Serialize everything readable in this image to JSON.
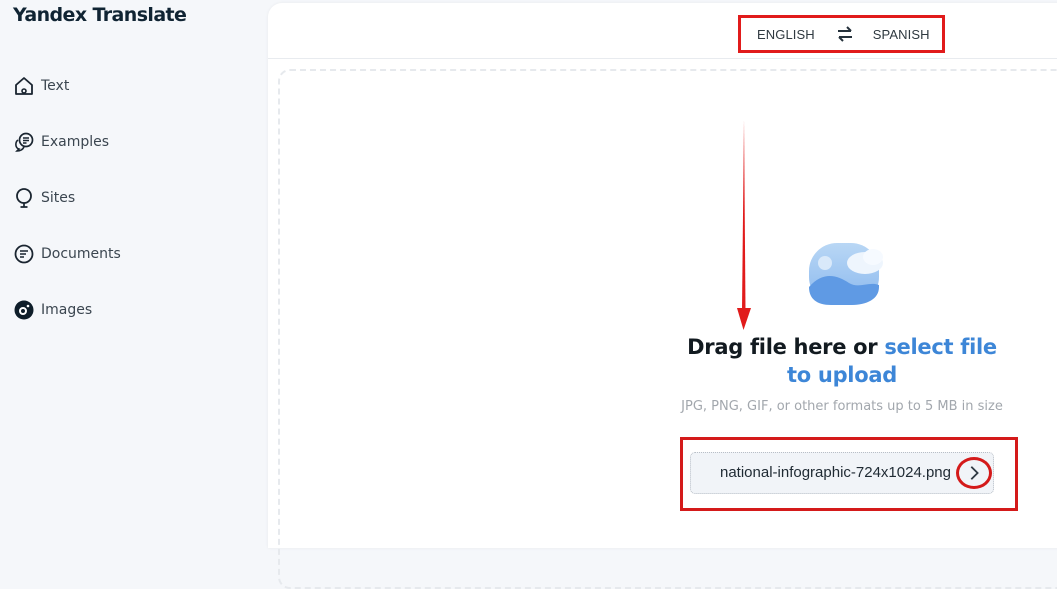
{
  "app": {
    "title": "Yandex Translate"
  },
  "sidebar": {
    "items": [
      {
        "label": "Text",
        "icon": "home-icon",
        "active": false
      },
      {
        "label": "Examples",
        "icon": "chat-bubbles-icon",
        "active": false
      },
      {
        "label": "Sites",
        "icon": "globe-icon",
        "active": false
      },
      {
        "label": "Documents",
        "icon": "document-icon",
        "active": false
      },
      {
        "label": "Images",
        "icon": "camera-icon",
        "active": true
      }
    ]
  },
  "languages": {
    "source": "ENGLISH",
    "target": "SPANISH",
    "swap_icon": "swap-arrows-icon"
  },
  "upload": {
    "title_prefix": "Drag file here or ",
    "title_link": "select file to upload",
    "hint": "JPG, PNG, GIF, or other formats up to 5 MB in size",
    "file_name": "national-infographic-724x1024.png",
    "submit_icon": "chevron-right-icon"
  },
  "colors": {
    "accent_link": "#3d86d7",
    "annotation_red": "#e11b1b",
    "sidebar_bg": "#f5f7fa"
  }
}
